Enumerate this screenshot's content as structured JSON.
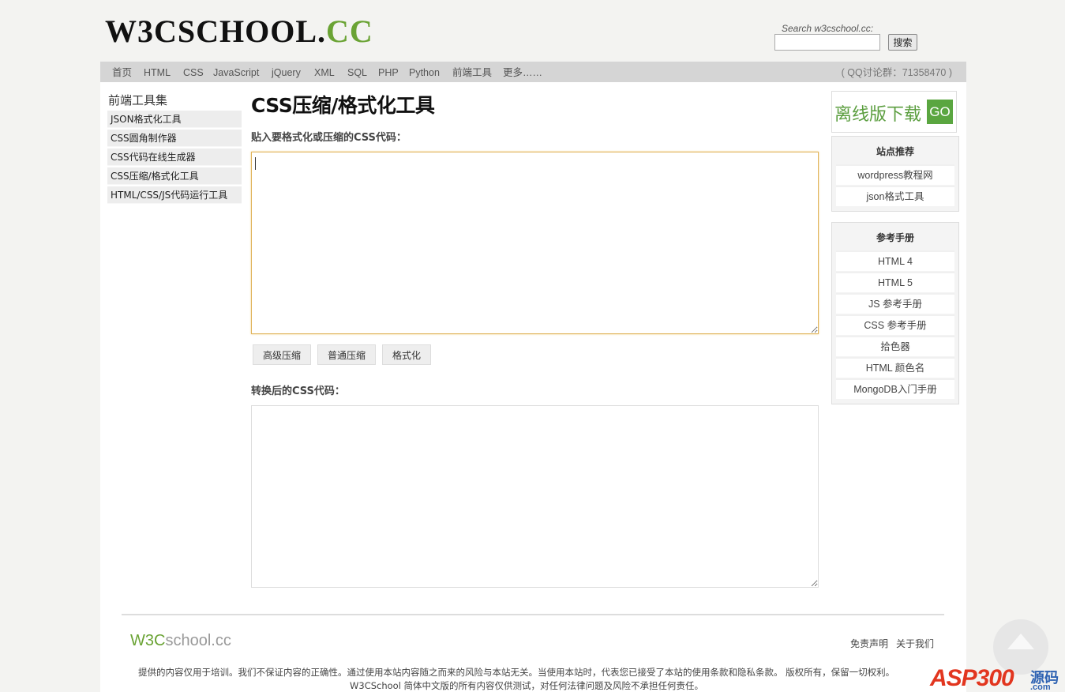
{
  "header": {
    "logo_main": "W3CSCHOOL.",
    "logo_cc": "CC",
    "search_label": "Search w3cschool.cc:",
    "search_value": "",
    "search_button": "搜索"
  },
  "topnav": {
    "items": [
      "首页",
      "HTML",
      "CSS",
      "JavaScript",
      "jQuery",
      "XML",
      "SQL",
      "PHP",
      "Python",
      "前端工具",
      "更多……"
    ],
    "qq": "( QQ讨论群：71358470 )"
  },
  "sidebar": {
    "title": "前端工具集",
    "items": [
      "JSON格式化工具",
      "CSS圆角制作器",
      "CSS代码在线生成器",
      "CSS压缩/格式化工具",
      "HTML/CSS/JS代码运行工具"
    ]
  },
  "main": {
    "title": "CSS压缩/格式化工具",
    "input_label": "贴入要格式化或压缩的CSS代码：",
    "input_value": "",
    "buttons": [
      "高级压缩",
      "普通压缩",
      "格式化"
    ],
    "output_label": "转换后的CSS代码：",
    "output_value": ""
  },
  "rightcol": {
    "offline_text": "离线版下载",
    "offline_go": "GO",
    "recommend_title": "站点推荐",
    "recommend_items": [
      "wordpress教程网",
      "json格式工具"
    ],
    "reference_title": "参考手册",
    "reference_items": [
      "HTML 4",
      "HTML 5",
      "JS 参考手册",
      "CSS 参考手册",
      "拾色器",
      "HTML 颜色名",
      "MongoDB入门手册"
    ]
  },
  "footer": {
    "logo_green": "W3C",
    "logo_gray": "school.cc",
    "links": [
      "免责声明",
      "关于我们"
    ],
    "text1": "提供的内容仅用于培训。我们不保证内容的正确性。通过使用本站内容随之而来的风险与本站无关。当使用本站时，代表您已接受了本站的使用条款和隐私条款。 版权所有，保留一切权利。",
    "text2": "W3CSchool 简体中文版的所有内容仅供测试，对任何法律问题及风险不承担任何责任。"
  },
  "watermark": {
    "text": "ASP300",
    "cn": "源码",
    "dom": ".com"
  },
  "colors": {
    "brand_green": "#6aa334",
    "active_border": "#e0b35a",
    "nav_bg": "#d5d5d5",
    "page_bg": "#f3f3f1"
  },
  "icons": [
    "back-to-top-icon"
  ]
}
